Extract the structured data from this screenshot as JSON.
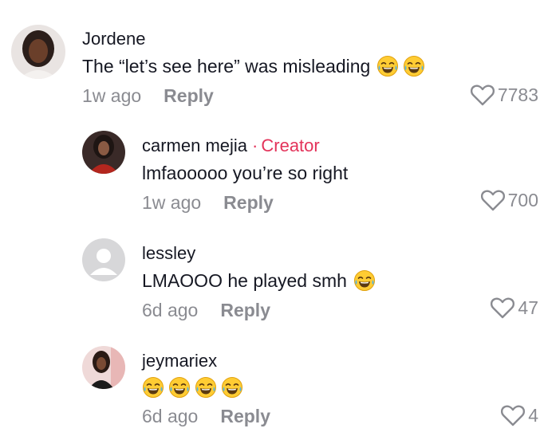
{
  "comments": [
    {
      "username": "Jordene",
      "text": "The “let’s see here” was misleading",
      "emoji_count": 2,
      "time": "1w ago",
      "reply_label": "Reply",
      "likes": "7783"
    },
    {
      "username": "carmen mejia",
      "creator_dot": "·",
      "creator_label": "Creator",
      "text": "lmfaooooo you’re so right",
      "emoji_count": 0,
      "time": "1w ago",
      "reply_label": "Reply",
      "likes": "700"
    },
    {
      "username": "lessley",
      "text": "LMAOOO he played smh",
      "emoji_count": 1,
      "time": "6d ago",
      "reply_label": "Reply",
      "likes": "47"
    },
    {
      "username": "jeymariex",
      "text": "",
      "emoji_count": 4,
      "time": "6d ago",
      "reply_label": "Reply",
      "likes": "4"
    }
  ],
  "icons": {
    "like": "heart-outline-icon",
    "emoji": "face-with-tears-of-joy-icon",
    "default_avatar": "person-placeholder-icon"
  },
  "colors": {
    "creator_accent": "#e3335a",
    "meta_gray": "#8a8b91",
    "text": "#161823",
    "emoji_yellow": "#ffcc33"
  }
}
